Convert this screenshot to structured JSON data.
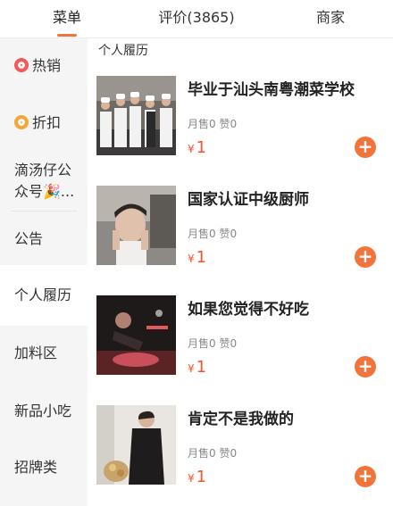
{
  "tabs": [
    {
      "label": "菜单"
    },
    {
      "label": "评价(3865)"
    },
    {
      "label": "商家"
    }
  ],
  "sidebar": {
    "items": [
      {
        "label": "热销",
        "icon": "hot-icon"
      },
      {
        "label": "折扣",
        "icon": "discount-icon"
      },
      {
        "label": "滴汤仔公众号🎉..."
      },
      {
        "label": "公告"
      },
      {
        "label": "个人履历"
      },
      {
        "label": "加料区"
      },
      {
        "label": "新品小吃"
      },
      {
        "label": "招牌类"
      }
    ]
  },
  "main": {
    "section_title": "个人履历",
    "items": [
      {
        "name": "毕业于汕头南粤潮菜学校",
        "stats": "月售0 赞0",
        "currency": "¥",
        "price": "1",
        "add": "+"
      },
      {
        "name": "国家认证中级厨师",
        "stats": "月售0 赞0",
        "currency": "¥",
        "price": "1",
        "add": "+"
      },
      {
        "name": "如果您觉得不好吃",
        "stats": "月售0 赞0",
        "currency": "¥",
        "price": "1",
        "add": "+"
      },
      {
        "name": "肯定不是我做的",
        "stats": "月售0 赞0",
        "currency": "¥",
        "price": "1",
        "add": "+"
      }
    ]
  },
  "colors": {
    "accent": "#f3743a",
    "price": "#f2552c"
  }
}
